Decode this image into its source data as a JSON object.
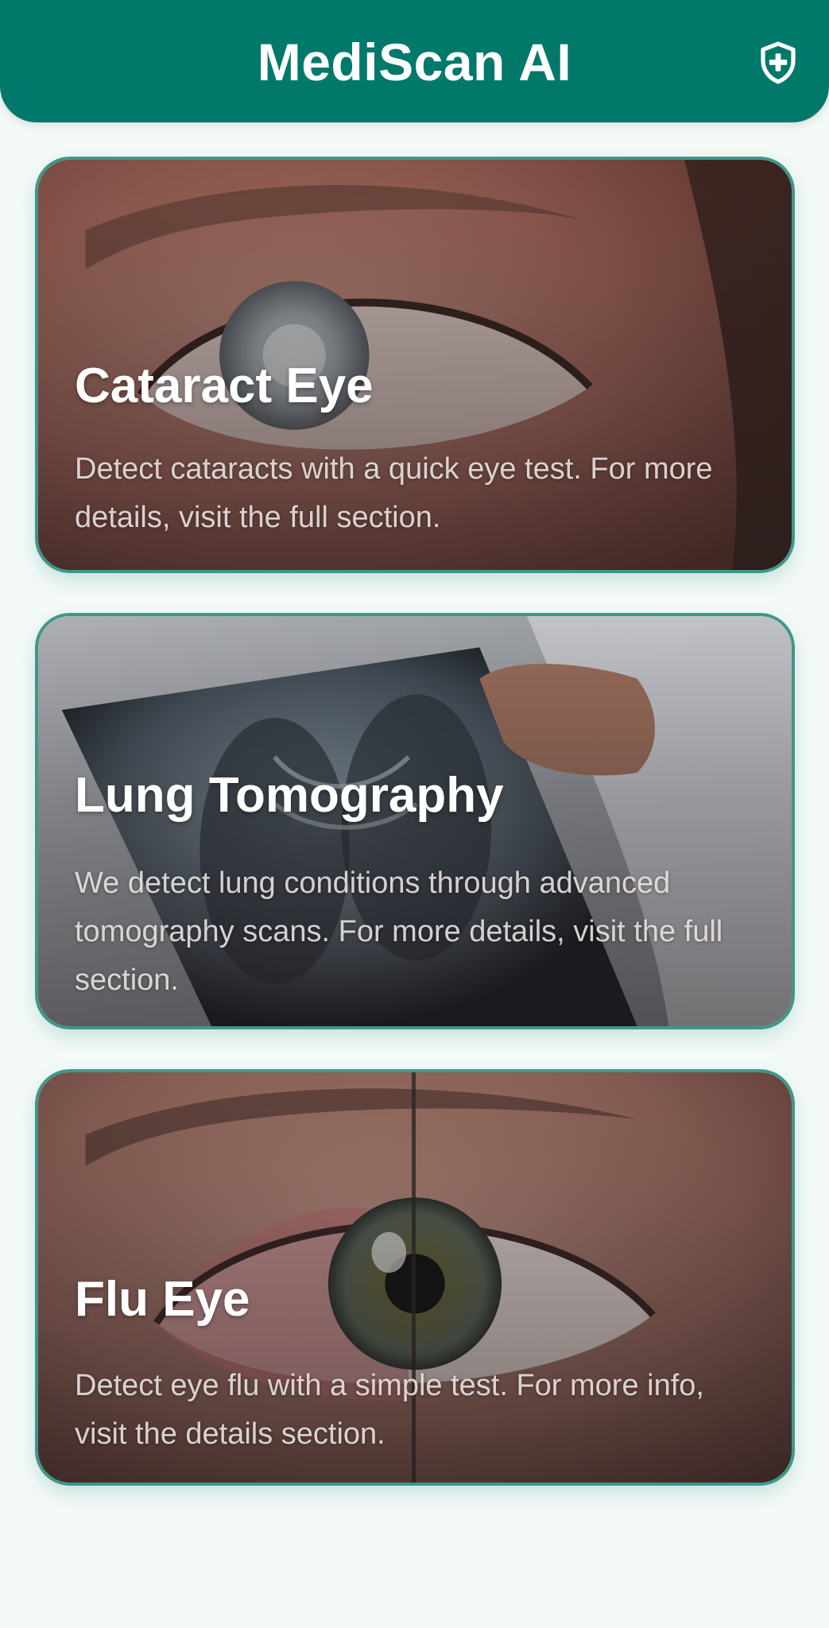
{
  "header": {
    "title": "MediScan AI",
    "action_icon": "shield-plus-icon"
  },
  "cards": [
    {
      "title": "Cataract Eye",
      "description": "Detect cataracts with a quick eye test. For more details, visit the full section."
    },
    {
      "title": "Lung Tomography",
      "description": "We detect lung conditions through advanced tomography scans. For more details, visit the full section."
    },
    {
      "title": "Flu Eye",
      "description": "Detect eye flu with a simple test. For more info, visit the details section."
    }
  ],
  "colors": {
    "primary": "#00796b",
    "card_border": "#3f978a",
    "background": "#f2f9f7"
  }
}
